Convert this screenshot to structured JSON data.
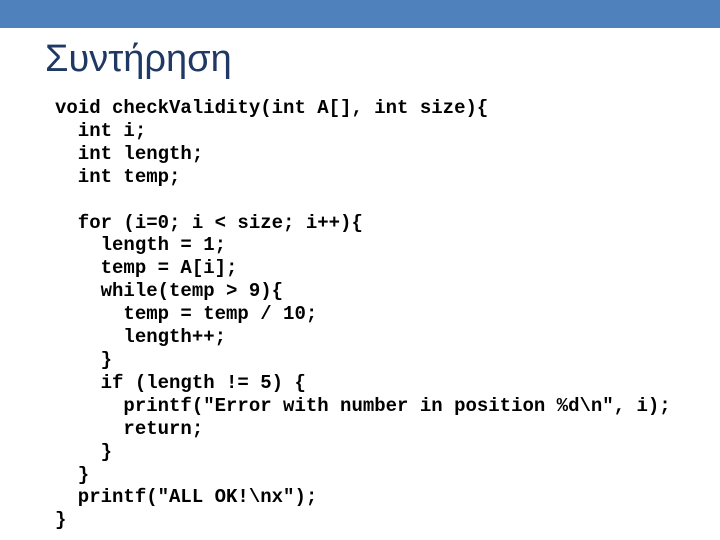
{
  "slide": {
    "title": "Συντήρηση",
    "accent_color": "#4f81bd",
    "title_color": "#1f3864",
    "code_lines": [
      "void checkValidity(int A[], int size){",
      "  int i;",
      "  int length;",
      "  int temp;",
      "",
      "  for (i=0; i < size; i++){",
      "    length = 1;",
      "    temp = A[i];",
      "    while(temp > 9){",
      "      temp = temp / 10;",
      "      length++;",
      "    }",
      "    if (length != 5) {",
      "      printf(\"Error with number in position %d\\n\", i);",
      "      return;",
      "    }",
      "  }",
      "  printf(\"ALL OK!\\nx\");",
      "}"
    ]
  }
}
